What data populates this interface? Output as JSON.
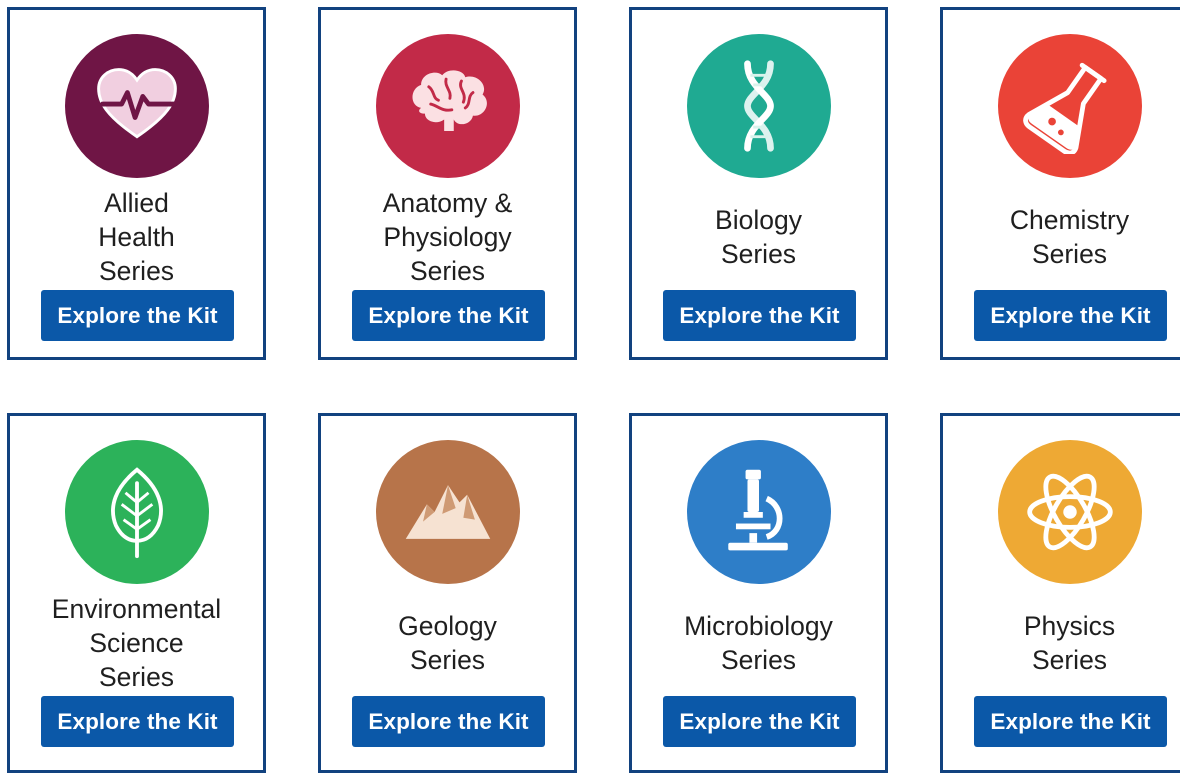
{
  "colors": {
    "card_border": "#12427f",
    "button": "#0b58a8"
  },
  "cards": [
    {
      "title": "Allied\nHealth\nSeries",
      "button_label": "Explore the Kit",
      "icon": "heart-pulse-icon",
      "color": "#6f1545"
    },
    {
      "title": "Anatomy &\nPhysiology\nSeries",
      "button_label": "Explore the Kit",
      "icon": "brain-icon",
      "color": "#c22a48"
    },
    {
      "title": "Biology\nSeries",
      "button_label": "Explore the Kit",
      "icon": "dna-icon",
      "color": "#1faa92"
    },
    {
      "title": "Chemistry\nSeries",
      "button_label": "Explore the Kit",
      "icon": "flask-icon",
      "color": "#ea4337"
    },
    {
      "title": "Environmental\nScience\nSeries",
      "button_label": "Explore the Kit",
      "icon": "leaf-icon",
      "color": "#2cb25a"
    },
    {
      "title": "Geology\nSeries",
      "button_label": "Explore the Kit",
      "icon": "mountain-icon",
      "color": "#b7744a"
    },
    {
      "title": "Microbiology\nSeries",
      "button_label": "Explore the Kit",
      "icon": "microscope-icon",
      "color": "#2e7ec8"
    },
    {
      "title": "Physics\nSeries",
      "button_label": "Explore the Kit",
      "icon": "atom-icon",
      "color": "#eea934"
    }
  ]
}
